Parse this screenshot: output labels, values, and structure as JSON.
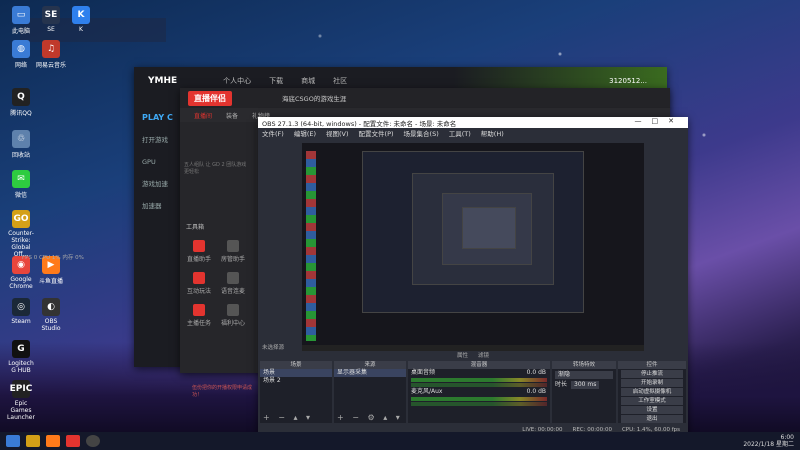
{
  "desktop_icons": [
    {
      "label": "此电脑",
      "color": "#3a7bd5",
      "glyph": "▭"
    },
    {
      "label": "SE",
      "color": "#26344e",
      "glyph": "SE"
    },
    {
      "label": "K",
      "color": "#2f80ed",
      "glyph": "K"
    },
    {
      "label": "网络",
      "color": "#3a7bd5",
      "glyph": "◍"
    },
    {
      "label": "网易云音乐",
      "color": "#c0392b",
      "glyph": "♫"
    },
    {
      "label": "腾讯QQ",
      "color": "#222",
      "glyph": "Q"
    },
    {
      "label": "回收站",
      "color": "#5e81ac",
      "glyph": "♲"
    },
    {
      "label": "微信",
      "color": "#2ecc40",
      "glyph": "✉"
    },
    {
      "label": "Counter-Strike: Global Off...",
      "color": "#d4a017",
      "glyph": "GO"
    },
    {
      "label": "Google Chrome",
      "color": "#e8453c",
      "glyph": "◉"
    },
    {
      "label": "斗鱼直播",
      "color": "#ff7a1a",
      "glyph": "▶"
    },
    {
      "label": "Steam",
      "color": "#1b2838",
      "glyph": "◎"
    },
    {
      "label": "OBS Studio",
      "color": "#333",
      "glyph": "◐"
    },
    {
      "label": "Logitech G HUB",
      "color": "#111",
      "glyph": "G"
    },
    {
      "label": "Epic Games Launcher",
      "color": "#222",
      "glyph": "EPIC"
    }
  ],
  "hama": {
    "logo": "YMHE",
    "tabs": [
      "个人中心",
      "下载",
      "商城",
      "社区"
    ],
    "user": "3120512...",
    "menu": [
      "PLAY C",
      "打开游戏",
      "GPU",
      "游戏加速",
      "加速器"
    ]
  },
  "zhibo": {
    "logo": "直播伴侣",
    "title": "海底CSGO的游戏生涯",
    "nav": [
      "直播间",
      "装备",
      "礼物榜"
    ],
    "hint": "五人组队 让 GD 2 团队游戏 更轻松",
    "tools_title": "工具箱",
    "tools": [
      "直播助手",
      "房管助手",
      "互动玩法",
      "语音连麦",
      "主播任务",
      "福利中心"
    ],
    "notice": "伍份把你的开播权限申请成功！"
  },
  "obs": {
    "title": "OBS 27.1.3 (64-bit, windows) - 配置文件: 未命名 - 场景: 未命名",
    "menu": [
      "文件(F)",
      "编辑(E)",
      "视图(V)",
      "配置文件(P)",
      "场景集合(S)",
      "工具(T)",
      "帮助(H)"
    ],
    "sub": [
      "属性",
      "滤镜"
    ],
    "source_bar": "未选择源",
    "docks": {
      "scenes": {
        "title": "场景",
        "items": [
          "场景",
          "场景 2"
        ]
      },
      "sources": {
        "title": "来源",
        "items": [
          "显示器采集"
        ]
      },
      "mixer": {
        "title": "混音器",
        "tracks": [
          {
            "name": "桌面音频",
            "db": "0.0 dB"
          },
          {
            "name": "麦克风/Aux",
            "db": "0.0 dB"
          }
        ]
      },
      "transitions": {
        "title": "转场特效",
        "type": "渐隐",
        "duration_label": "时长",
        "duration": "300 ms"
      },
      "controls": {
        "title": "控件",
        "buttons": [
          "停止推流",
          "开始录制",
          "启动虚拟摄像机",
          "工作室模式",
          "设置",
          "退出"
        ]
      }
    },
    "status": {
      "live": "LIVE: 00:00:00",
      "rec": "REC: 00:00:00",
      "cpu": "CPU: 1.4%, 60.00 fps"
    }
  },
  "stat_line": "FPS 0  CPU 1%  内存 0%",
  "clock": {
    "time": "6:00",
    "date": "2022/1/18 星期二"
  }
}
